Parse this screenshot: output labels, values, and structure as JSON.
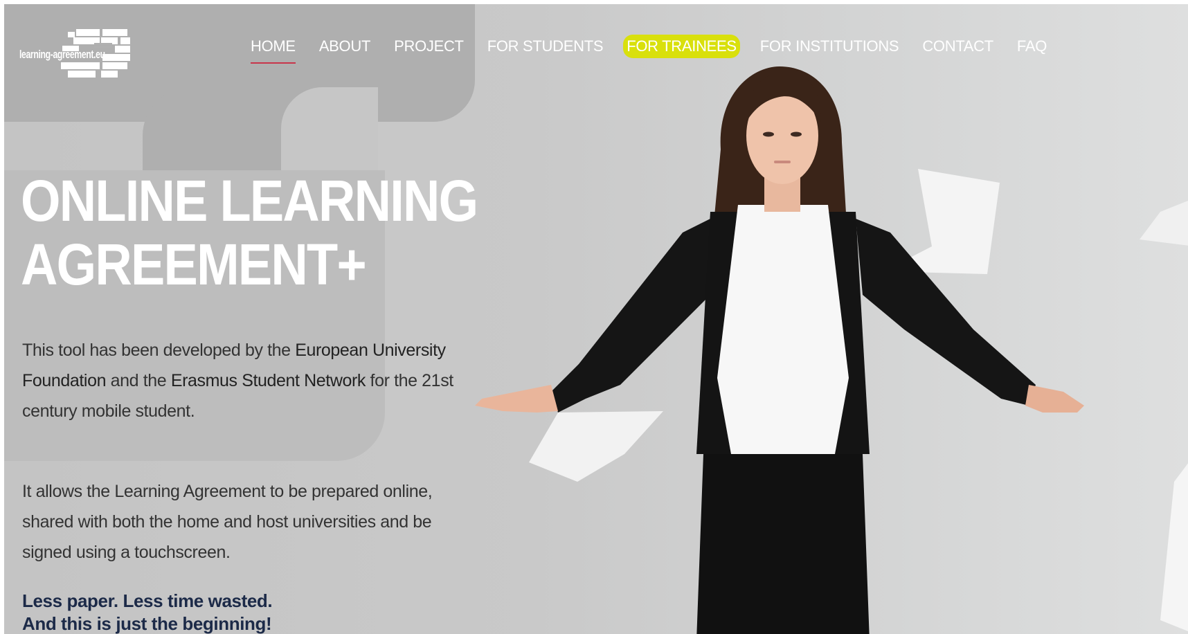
{
  "logo": {
    "text": "learning-agreement.eu"
  },
  "nav": {
    "items": [
      {
        "label": "HOME"
      },
      {
        "label": "ABOUT"
      },
      {
        "label": "PROJECT"
      },
      {
        "label": "FOR STUDENTS"
      },
      {
        "label": "FOR TRAINEES"
      },
      {
        "label": "FOR INSTITUTIONS"
      },
      {
        "label": "CONTACT"
      },
      {
        "label": "FAQ"
      }
    ],
    "active_color": "#c8344a",
    "highlight_color": "#d9e00c"
  },
  "hero": {
    "title_line1": "ONLINE LEARNING",
    "title_line2": "AGREEMENT+",
    "para1": {
      "t1": "This tool has been developed by the ",
      "b1": "European University Foundation",
      "t2": " and the ",
      "b2": "Erasmus Student Network",
      "t3": " for the 21st century mobile student."
    },
    "para2": "It allows the Learning Agreement to be prepared online, shared with both the home and host universities and be signed using a touchscreen.",
    "tagline1": "Less paper. Less time wasted.",
    "tagline2": "And this is just the beginning!"
  }
}
